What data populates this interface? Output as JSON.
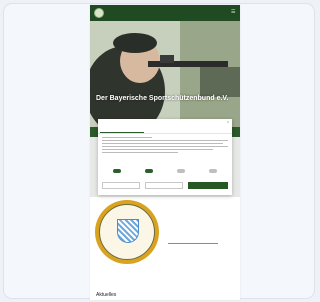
{
  "site": {
    "logo_text": "",
    "hero_title": "Der Bayerische Sportschützenbund e.V."
  },
  "cookie_modal": {
    "tabs": [
      "",
      "",
      ""
    ],
    "toggles": [
      {
        "label": "",
        "on": true
      },
      {
        "label": "",
        "on": true
      },
      {
        "label": "",
        "on": false
      },
      {
        "label": "",
        "on": false
      }
    ],
    "buttons": [
      "",
      "",
      ""
    ]
  },
  "section": {
    "news_heading": "Aktuelles"
  },
  "colors": {
    "brand_green": "#1f4a22",
    "accent_green": "#255824",
    "seal_gold": "#d9a320"
  }
}
